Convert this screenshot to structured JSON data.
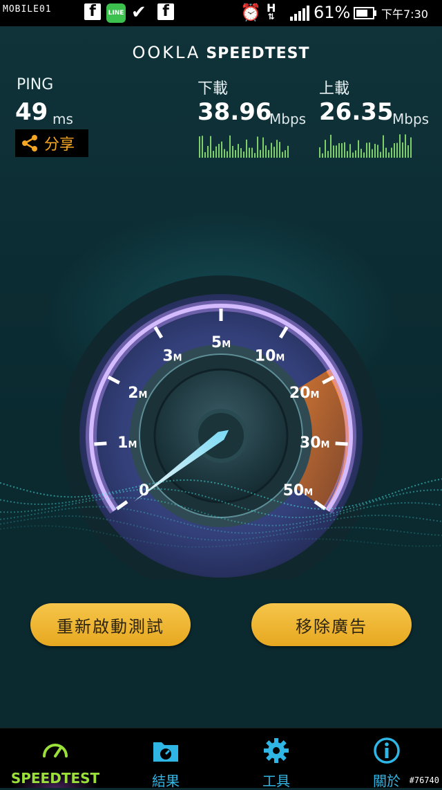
{
  "statusbar": {
    "watermark": "MOBILE01",
    "network": "H",
    "battery": "61%",
    "time": "下午7:30",
    "icons": [
      "facebook-icon",
      "line-icon",
      "check-icon",
      "facebook-icon",
      "alarm-icon",
      "signal-icon",
      "battery-icon"
    ]
  },
  "header": {
    "brand_ookla": "OOKLA",
    "brand_speedtest": "SPEEDTEST"
  },
  "ping": {
    "label": "PING",
    "value": "49",
    "unit": "ms"
  },
  "share": {
    "label": "分享"
  },
  "download": {
    "label": "下載",
    "value": "38.96",
    "unit": "Mbps"
  },
  "upload": {
    "label": "上載",
    "value": "26.35",
    "unit": "Mbps"
  },
  "gauge": {
    "ticks": [
      {
        "n": "0",
        "u": ""
      },
      {
        "n": "1",
        "u": "M"
      },
      {
        "n": "2",
        "u": "M"
      },
      {
        "n": "3",
        "u": "M"
      },
      {
        "n": "5",
        "u": "M"
      },
      {
        "n": "10",
        "u": "M"
      },
      {
        "n": "20",
        "u": "M"
      },
      {
        "n": "30",
        "u": "M"
      },
      {
        "n": "50",
        "u": "M"
      }
    ],
    "needle_value": "0",
    "accent_color": "#ff8a2a",
    "ring_color": "#d9c8ff"
  },
  "buttons": {
    "restart": "重新啟動測試",
    "remove_ads": "移除廣告"
  },
  "nav": {
    "items": [
      {
        "label": "SPEEDTEST",
        "icon": "speedometer-icon",
        "active": true
      },
      {
        "label": "結果",
        "icon": "results-folder-icon",
        "active": false
      },
      {
        "label": "工具",
        "icon": "gear-icon",
        "active": false
      },
      {
        "label": "關於",
        "icon": "info-icon",
        "active": false
      }
    ]
  },
  "image_tag": "#76740"
}
